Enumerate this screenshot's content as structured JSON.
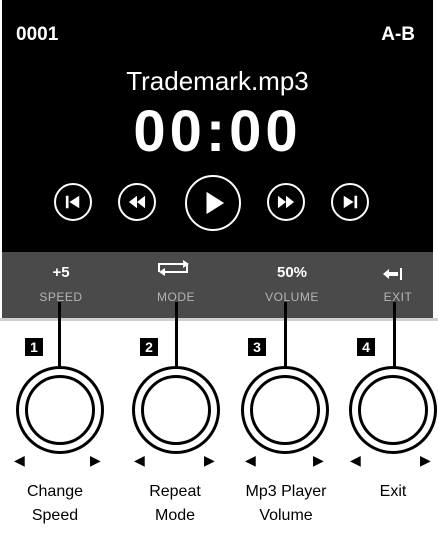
{
  "display": {
    "track_number": "0001",
    "ab_label": "A-B",
    "filename": "Trademark.mp3",
    "time": "00:00"
  },
  "transport": [
    "skip-previous",
    "rewind",
    "play",
    "fast-forward",
    "skip-next"
  ],
  "strip": {
    "speed_value": "+5",
    "speed_label": "SPEED",
    "mode_label": "MODE",
    "volume_value": "50%",
    "volume_label": "VOLUME",
    "exit_label": "EXIT"
  },
  "knobs": [
    {
      "number": "1",
      "caption_line1": "Change",
      "caption_line2": "Speed"
    },
    {
      "number": "2",
      "caption_line1": "Repeat",
      "caption_line2": "Mode"
    },
    {
      "number": "3",
      "caption_line1": "Mp3 Player",
      "caption_line2": "Volume"
    },
    {
      "number": "4",
      "caption_line1": "Exit",
      "caption_line2": ""
    }
  ],
  "colors": {
    "screen_bg": "#000000",
    "strip_bg": "#4a4a4a",
    "text": "#ffffff",
    "muted": "#b4b4b4"
  }
}
